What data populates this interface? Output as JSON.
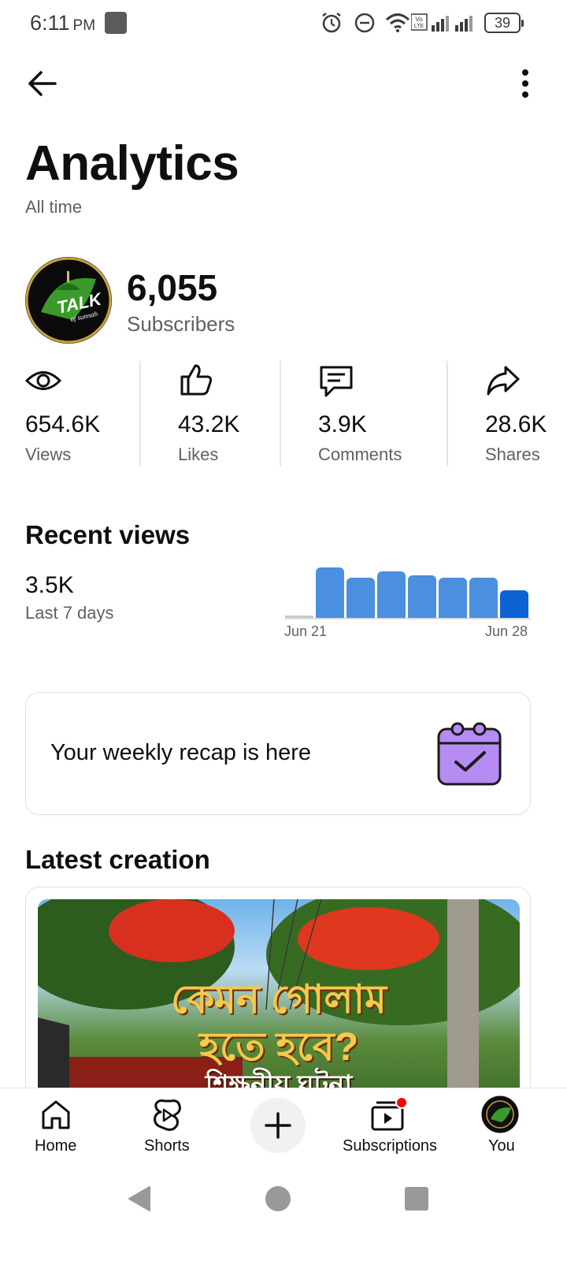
{
  "status_bar": {
    "time": "6:11",
    "ampm": "PM",
    "battery": "39"
  },
  "header": {
    "title": "Analytics",
    "subtitle": "All time"
  },
  "channel": {
    "subscriber_count": "6,055",
    "subscriber_label": "Subscribers",
    "avatar_text": "TALK",
    "avatar_subtext": "of sunnah"
  },
  "stats": [
    {
      "value": "654.6K",
      "label": "Views",
      "icon": "eye-icon"
    },
    {
      "value": "43.2K",
      "label": "Likes",
      "icon": "thumbs-up-icon"
    },
    {
      "value": "3.9K",
      "label": "Comments",
      "icon": "comment-icon"
    },
    {
      "value": "28.6K",
      "label": "Shares",
      "icon": "share-icon"
    }
  ],
  "recent_views": {
    "title": "Recent views",
    "value": "3.5K",
    "period": "Last 7 days",
    "axis_start": "Jun 21",
    "axis_end": "Jun 28"
  },
  "chart_data": {
    "type": "bar",
    "categories": [
      "",
      "",
      "",
      "",
      "",
      "",
      "",
      ""
    ],
    "values": [
      0.05,
      1.0,
      0.8,
      0.92,
      0.85,
      0.8,
      0.8,
      0.55
    ],
    "xlabel": "",
    "ylabel": "",
    "x_tick_labels": [
      "Jun 21",
      "Jun 28"
    ],
    "colors": {
      "past": "#4a8fe0",
      "current": "#0d62d6",
      "empty": "#c9c9c9"
    }
  },
  "recap": {
    "text": "Your weekly recap is here"
  },
  "latest": {
    "title": "Latest creation",
    "thumb_line1": "কেমন গোলাম",
    "thumb_line2": "হতে হবে?",
    "thumb_line3": "শিক্ষনীয় ঘটনা"
  },
  "bottom_nav": [
    {
      "label": "Home",
      "icon": "home-icon"
    },
    {
      "label": "Shorts",
      "icon": "shorts-icon"
    },
    {
      "label": "Subscriptions",
      "icon": "subscriptions-icon"
    },
    {
      "label": "You",
      "icon": "avatar-icon"
    }
  ],
  "colors": {
    "accent_red": "#ff0000",
    "recap_purple": "#b48cf2"
  }
}
